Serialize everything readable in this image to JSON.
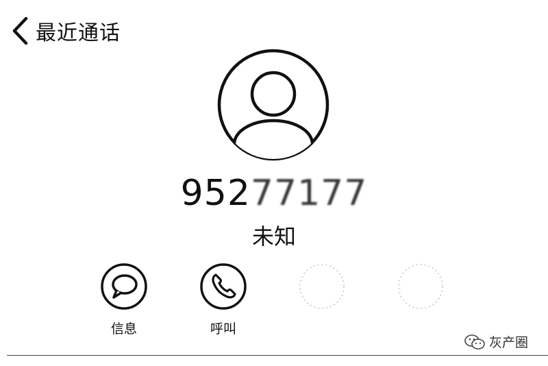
{
  "nav": {
    "back_icon": "chevron-left-icon",
    "title": "最近通话"
  },
  "contact": {
    "avatar_icon": "user-avatar-icon",
    "number_visible": "952",
    "number_masked": "77177",
    "location": "未知"
  },
  "actions": [
    {
      "label": "信息",
      "icon": "message-bubble-icon"
    },
    {
      "label": "呼叫",
      "icon": "phone-icon"
    },
    {
      "label": "",
      "icon": "blurred-action-icon"
    },
    {
      "label": "",
      "icon": "blurred-action-icon"
    }
  ],
  "watermark": {
    "icon": "wechat-icon",
    "text": "灰产圈"
  }
}
